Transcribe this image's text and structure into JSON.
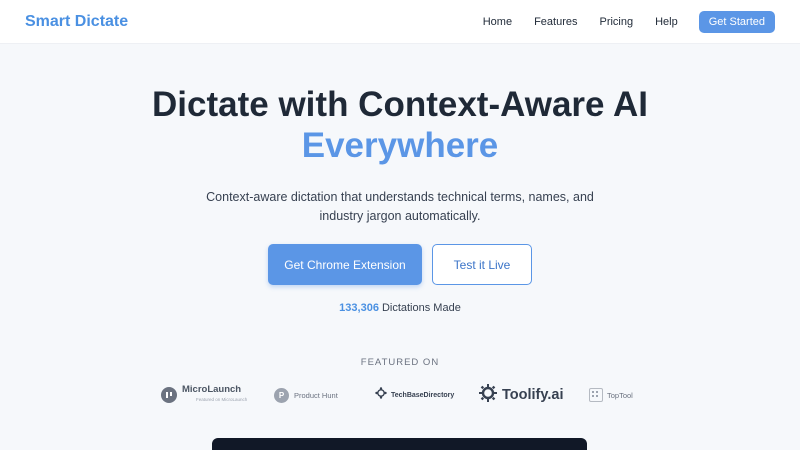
{
  "nav": {
    "brand": "Smart Dictate",
    "links": [
      "Home",
      "Features",
      "Pricing",
      "Help"
    ],
    "cta": "Get Started"
  },
  "hero": {
    "title": "Dictate with Context-Aware AI",
    "title_accent": "Everywhere",
    "subtitle": "Context-aware dictation that understands technical terms, names, and industry jargon automatically.",
    "primary_button": "Get Chrome Extension",
    "secondary_button": "Test it Live",
    "stats_count": "133,306",
    "stats_label": "Dictations Made"
  },
  "featured": {
    "label": "FEATURED ON",
    "logos": [
      {
        "name": "MicroLaunch",
        "tagline": "Featured on MicroLaunch",
        "icon": "microlaunch-icon"
      },
      {
        "name": "Product Hunt",
        "icon": "product-hunt-icon",
        "mark": "P"
      },
      {
        "name": "TechBaseDirectory",
        "icon": "techbase-icon"
      },
      {
        "name": "Toolify.ai",
        "icon": "toolify-icon"
      },
      {
        "name": "TopTool",
        "icon": "toptool-icon"
      }
    ]
  },
  "colors": {
    "accent": "#5b96e6",
    "brand": "#4a90e2",
    "text": "#1f2937",
    "background": "#f6f8fb"
  }
}
